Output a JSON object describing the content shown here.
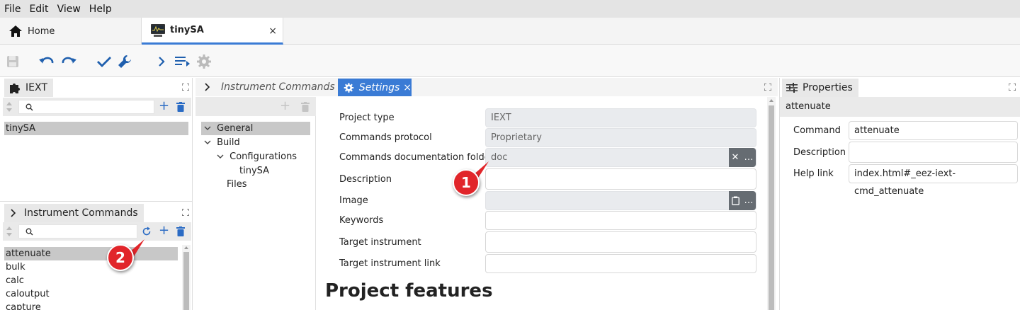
{
  "menu": {
    "file": "File",
    "edit": "Edit",
    "view": "View",
    "help": "Help"
  },
  "tabs": {
    "home": "Home",
    "project": "tinySA",
    "close": "×"
  },
  "iext_panel": {
    "title": "IEXT",
    "items": [
      "tinySA"
    ]
  },
  "instrument_commands_panel": {
    "title": "Instrument Commands",
    "items": [
      "attenuate",
      "bulk",
      "calc",
      "caloutput",
      "capture"
    ]
  },
  "center": {
    "inactive_tab": "Instrument Commands",
    "settings_tab": "Settings",
    "settings_close": "×",
    "tree": {
      "general": "General",
      "build": "Build",
      "configurations": "Configurations",
      "config_item": "tinySA",
      "files": "Files"
    },
    "form": {
      "project_type_label": "Project type",
      "project_type_value": "IEXT",
      "protocol_label": "Commands protocol",
      "protocol_value": "Proprietary",
      "doc_folder_label": "Commands documentation folder",
      "doc_folder_value": "doc",
      "description_label": "Description",
      "image_label": "Image",
      "keywords_label": "Keywords",
      "target_label": "Target instrument",
      "target_link_label": "Target instrument link"
    },
    "features_heading": "Project features"
  },
  "properties": {
    "title": "Properties",
    "selected": "attenuate",
    "command_label": "Command",
    "command_value": "attenuate",
    "description_label": "Description",
    "description_value": "",
    "help_label": "Help link",
    "help_value": "index.html#_eez-iext-cmd_attenuate"
  },
  "annotations": {
    "badge1": "1",
    "badge2": "2"
  },
  "colors": {
    "accent": "#3a7bd5",
    "badge": "#e1252a",
    "selection": "#c8c8c8"
  }
}
